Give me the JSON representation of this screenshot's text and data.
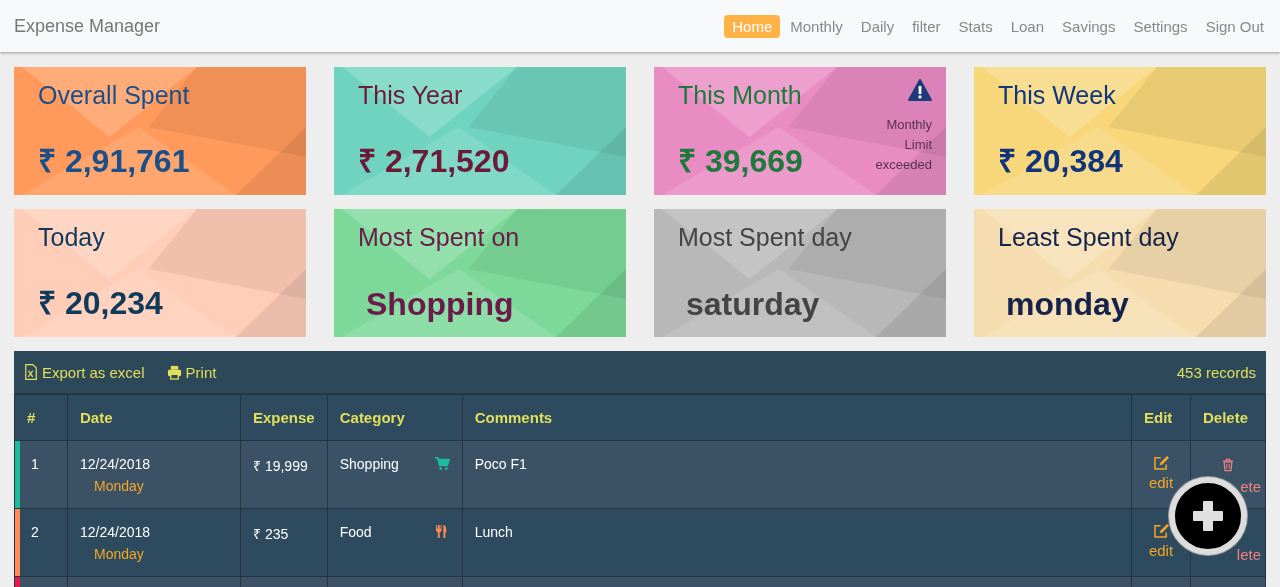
{
  "navbar": {
    "brand": "Expense Manager",
    "links": [
      {
        "label": "Home",
        "selected": true
      },
      {
        "label": "Monthly",
        "selected": false
      },
      {
        "label": "Daily",
        "selected": false
      },
      {
        "label": "filter",
        "selected": false
      },
      {
        "label": "Stats",
        "selected": false
      },
      {
        "label": "Loan",
        "selected": false
      },
      {
        "label": "Savings",
        "selected": false
      },
      {
        "label": "Settings",
        "selected": false
      },
      {
        "label": "Sign Out",
        "selected": false
      }
    ]
  },
  "cards": [
    {
      "title": "Overall Spent",
      "value": "₹ 2,91,761",
      "color": "#ff9a5c"
    },
    {
      "title": "This Year",
      "value": "₹ 2,71,520",
      "color": "#6fd3bf"
    },
    {
      "title": "This Month",
      "value": "₹ 39,669",
      "color": "#e98cc4",
      "alert": "Monthly Limit exceeded"
    },
    {
      "title": "This Week",
      "value": "₹ 20,384",
      "color": "#f7d77a"
    },
    {
      "title": "Today",
      "value": "₹ 20,234",
      "color": "#ffcdb8"
    },
    {
      "title": "Most Spent on",
      "value": "Shopping",
      "color": "#7dd99a"
    },
    {
      "title": "Most Spent day",
      "value": "saturday",
      "color": "#b8b8b8"
    },
    {
      "title": "Least Spent day",
      "value": "monday",
      "color": "#f6ddb0"
    }
  ],
  "table": {
    "toolbar": {
      "export": "Export as excel",
      "print": "Print",
      "count": "453 records"
    },
    "columns": [
      "#",
      "Date",
      "Expense",
      "Category",
      "Comments",
      "Edit",
      "Delete"
    ],
    "rows": [
      {
        "number": "1",
        "date": "12/24/2018",
        "weekday": "Monday",
        "expense": "₹ 19,999",
        "category": "Shopping",
        "kind": "cart",
        "comments": "Poco F1",
        "edit": "edit",
        "delete": "ete",
        "delete_icon": true,
        "color": "#1abc9c"
      },
      {
        "number": "2",
        "date": "12/24/2018",
        "weekday": "Monday",
        "expense": "₹ 235",
        "category": "Food",
        "kind": "food",
        "comments": "Lunch",
        "edit": "edit",
        "delete": "lete",
        "delete_icon": false,
        "color": "#ff8c55"
      }
    ],
    "partial_row": {
      "color": "#e8174a"
    }
  }
}
